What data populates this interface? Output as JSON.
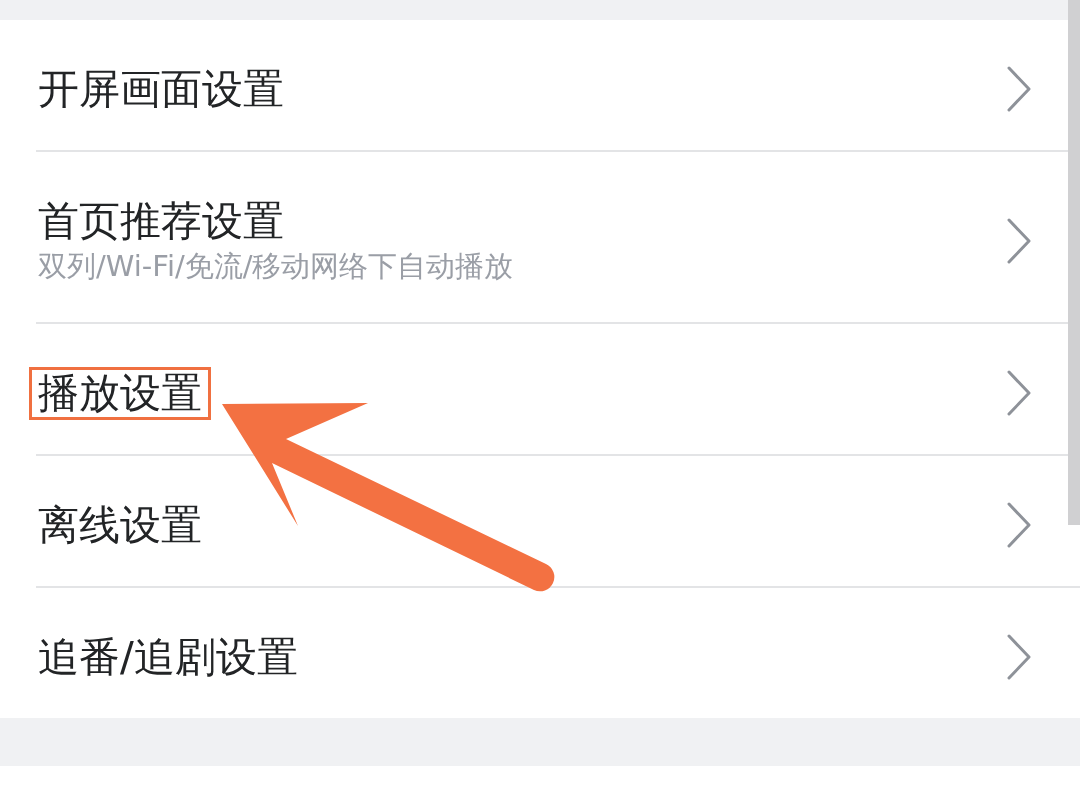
{
  "settings_list": {
    "items": [
      {
        "title": "开屏画面设置",
        "highlighted": false
      },
      {
        "title": "首页推荐设置",
        "subtitle": "双列/Wi-Fi/免流/移动网络下自动播放",
        "highlighted": false
      },
      {
        "title": "播放设置",
        "highlighted": true
      },
      {
        "title": "离线设置",
        "highlighted": false
      },
      {
        "title": "追番/追剧设置",
        "highlighted": false
      }
    ]
  }
}
